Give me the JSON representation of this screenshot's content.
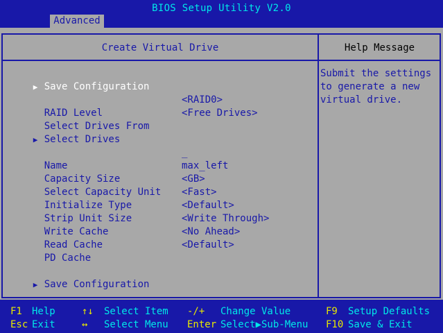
{
  "app_title": "BIOS Setup Utility V2.0",
  "tab_label": "Advanced",
  "section_title": "Create Virtual Drive",
  "help_title": "Help Message",
  "help_text": "Submit the settings\nto generate a new\nvirtual drive.",
  "arrow_glyph": "▶",
  "items": [
    {
      "label": "Save Configuration",
      "value": "",
      "arrow": "▶"
    },
    {
      "label": "RAID Level",
      "value": "<RAID0>",
      "arrow": ""
    },
    {
      "label": "Select Drives From",
      "value": "<Free Drives>",
      "arrow": ""
    },
    {
      "label": "Select Drives",
      "value": "",
      "arrow": "▶"
    },
    {
      "label": "Name",
      "value": "_",
      "arrow": ""
    },
    {
      "label": "Capacity Size",
      "value": "max_left",
      "arrow": ""
    },
    {
      "label": "Select Capacity Unit",
      "value": "<GB>",
      "arrow": ""
    },
    {
      "label": "Initialize Type",
      "value": "<Fast>",
      "arrow": ""
    },
    {
      "label": "Strip Unit Size",
      "value": "<Default>",
      "arrow": ""
    },
    {
      "label": "Write Cache",
      "value": "<Write Through>",
      "arrow": ""
    },
    {
      "label": "Read Cache",
      "value": "<No Ahead>",
      "arrow": ""
    },
    {
      "label": "PD Cache",
      "value": "<Default>",
      "arrow": ""
    },
    {
      "label": "Save Configuration",
      "value": "",
      "arrow": "▶"
    }
  ],
  "footer": {
    "f1_key": "F1",
    "f1_desc": "Help",
    "esc_key": "Esc",
    "esc_desc": "Exit",
    "updown_key": "↑↓",
    "updown_desc": "Select Item",
    "leftright_key": "↔",
    "leftright_desc": "Select Menu",
    "plusminus_key": "-/+",
    "plusminus_desc": "Change Value",
    "enter_key": "Enter",
    "enter_desc": "Select▶Sub-Menu",
    "f9_key": "F9",
    "f9_desc": "Setup Defaults",
    "f10_key": "F10",
    "f10_desc": "Save & Exit"
  },
  "colors": {
    "background": "#1818a8",
    "panel": "#a8a8a8",
    "title_text": "#00e8e8",
    "item_text": "#1818a8",
    "selected_text": "#ffffff"
  }
}
